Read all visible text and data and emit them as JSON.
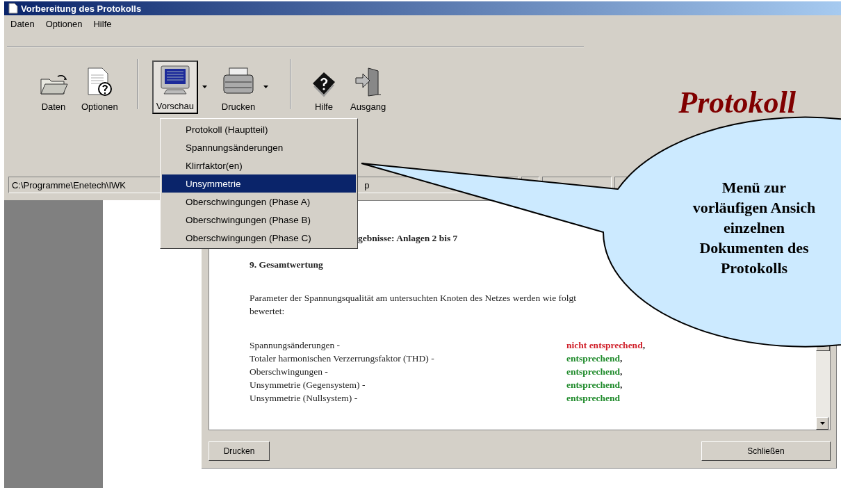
{
  "window": {
    "title": "Vorbereitung des Protokolls"
  },
  "menu_bar": [
    {
      "label": "Daten"
    },
    {
      "label": "Optionen"
    },
    {
      "label": "Hilfe"
    }
  ],
  "toolbar": [
    {
      "kind": "folder",
      "label": "Daten",
      "pressed": false
    },
    {
      "kind": "options",
      "label": "Optionen",
      "pressed": false
    },
    {
      "kind": "separator"
    },
    {
      "kind": "monitor",
      "label": "Vorschau",
      "pressed": true,
      "dropdown": true
    },
    {
      "kind": "printer",
      "label": "Drucken",
      "pressed": false,
      "dropdown": true
    },
    {
      "kind": "separator"
    },
    {
      "kind": "help",
      "label": "Hilfe",
      "pressed": false
    },
    {
      "kind": "exit",
      "label": "Ausgang",
      "pressed": false
    }
  ],
  "logo": "Protokoll",
  "path_bar": {
    "path": "C:\\Programme\\Enetech\\IWK",
    "tail": "p"
  },
  "preview_menu": [
    {
      "label": "Protokoll  (Hauptteil)",
      "selected": false
    },
    {
      "label": "Spannungsänderungen",
      "selected": false
    },
    {
      "label": "Klirrfaktor(en)",
      "selected": false
    },
    {
      "label": "Unsymmetrie",
      "selected": true
    },
    {
      "label": "Oberschwingungen (Phase A)",
      "selected": false
    },
    {
      "label": "Oberschwingungen (Phase B)",
      "selected": false
    },
    {
      "label": "Oberschwingungen (Phase C)",
      "selected": false
    }
  ],
  "document": {
    "heading": "gebnisse: Anlagen  2 bis 7",
    "section": "9.   Gesamtwertung",
    "paragraph": "Parameter der Spannungsqualität am untersuchten Knoten des Netzes werden wie folgt bewertet:",
    "results": [
      {
        "label": "Spannungsänderungen -",
        "result": "nicht entsprechend",
        "suffix": ",",
        "color": "#d0202a"
      },
      {
        "label": "Totaler harmonischen Verzerrungsfaktor (THD) -",
        "result": "entsprechend",
        "suffix": ",",
        "color": "#1e8a2a"
      },
      {
        "label": "Oberschwingungen -",
        "result": "entsprechend",
        "suffix": ",",
        "color": "#1e8a2a"
      },
      {
        "label": "Unsymmetrie (Gegensystem) -",
        "result": "entsprechend",
        "suffix": ",",
        "color": "#1e8a2a"
      },
      {
        "label": "Unsymmetrie (Nullsystem) -",
        "result": "entsprechend",
        "color": "#1e8a2a"
      }
    ]
  },
  "dialog_buttons": [
    "Drucken",
    "Schließen"
  ],
  "callout": {
    "lines": [
      "Menü zur",
      "vorläufigen Ansich",
      "einzelnen",
      "Dokumenten des",
      "Protokolls"
    ]
  }
}
